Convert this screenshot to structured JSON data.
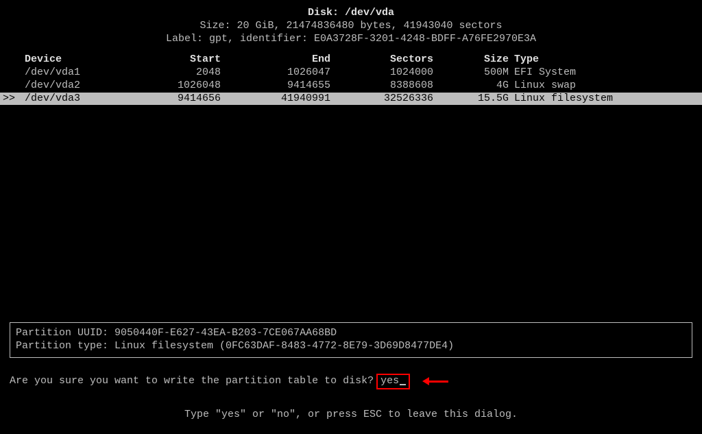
{
  "header": {
    "disk_label": "Disk: /dev/vda",
    "size_line": "Size: 20 GiB, 21474836480 bytes, 41943040 sectors",
    "label_line": "Label: gpt, identifier: E0A3728F-3201-4248-BDFF-A76FE2970E3A"
  },
  "columns": {
    "device": "Device",
    "start": "Start",
    "end": "End",
    "sectors": "Sectors",
    "size": "Size",
    "type": "Type"
  },
  "rows": [
    {
      "marker": "",
      "device": "/dev/vda1",
      "start": "2048",
      "end": "1026047",
      "sectors": "1024000",
      "size": "500M",
      "type": "EFI System"
    },
    {
      "marker": "",
      "device": "/dev/vda2",
      "start": "1026048",
      "end": "9414655",
      "sectors": "8388608",
      "size": "4G",
      "type": "Linux swap"
    },
    {
      "marker": ">>",
      "device": "/dev/vda3",
      "start": "9414656",
      "end": "41940991",
      "sectors": "32526336",
      "size": "15.5G",
      "type": "Linux filesystem",
      "selected": true
    }
  ],
  "info": {
    "uuid_line": "Partition UUID: 9050440F-E627-43EA-B203-7CE067AA68BD",
    "type_line": "Partition type: Linux filesystem (0FC63DAF-8483-4772-8E79-3D69D8477DE4)"
  },
  "prompt": {
    "question": "Are you sure you want to write the partition table to disk? ",
    "input_value": "yes"
  },
  "footer": {
    "hint": "Type \"yes\" or \"no\", or press ESC to leave this dialog."
  }
}
